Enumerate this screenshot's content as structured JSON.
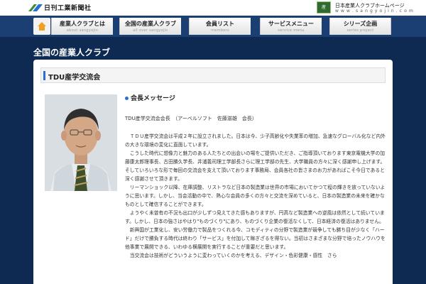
{
  "brand": {
    "name": "日刊工業新聞社"
  },
  "site": {
    "box_label": "産",
    "title": "日本産業人クラブホームページ",
    "url": "w w w . s a n g y o j i n . c o m"
  },
  "nav": {
    "items": [
      {
        "label": "産業人クラブとは",
        "sub": "about sangyojin"
      },
      {
        "label": "全国の産業人クラブ",
        "sub": "all over sangyojin"
      },
      {
        "label": "会員リスト",
        "sub": "members"
      },
      {
        "label": "サービスメニュー",
        "sub": "service menu"
      },
      {
        "label": "シリーズ企画",
        "sub": "series project"
      }
    ]
  },
  "page": {
    "title": "全国の産業人クラブ",
    "section_title": "TDU産学交流会"
  },
  "message": {
    "heading": "会長メッセージ",
    "author": "TDU産学交流会会長　（アーベルソフト　佐藤滋雄　会長）",
    "paragraphs": [
      "　ＴＤＵ産学交流会は平成２年に設立されました。日本は今、少子高齢化や失業率の増加、急速なグローバル化など内外の大きな環境の変化に直面しています。",
      "　こうした時代に想像力と魅力のある人たちとの出会いの場をご提供いただき、ご指導頂いております東京電機大学の加藤康太郎理事長、古田勝久学長、井浦義司理工学部長さらに理工学部の先生、大学職員の方々に深く感謝申し上げます。そしていろいろな形で毎回の交流会を支えて頂いております事務局、会員各社の皆さまのお力があればこそ今日であると深く感謝させて頂きます。",
      "　リーマンショック以降、在庫調整、リストラなど日本の製造業は世界の市場においてかつて程の輝きを放っていないように思います。しかし、当会活動の中で、熱心な会員の多くの方々と交流を深めていると、日本の製造業の未来を確かなものとして確信することができます。",
      "　ようやく未曾有の不況も出口が少しずつ見えてきた感もありますが、円高など製造業への逆風は依然として続いています。しかし、日本の強さはやはり\"ものづくり\"にあり、ものづくり企業の復活なくして、日本経済の復活はありません。",
      "　新興国が工業化し、安い労働力で製品をつくれる今、コモディティの分野で製造業が競争しても勝ち目が少なく「ハード」だけで勝負する時代は終わり「サービス」を付加して稼ぎざるを得ない。当初はさまざまな分野で培ったノウハウを他事業で展開できる、いわゆる横展開を実行することが重要だと思います。",
      "　当交流会は技術がどういうように変わっていくのかを考える、デザイン・色彩健康・感性　さら"
    ]
  }
}
